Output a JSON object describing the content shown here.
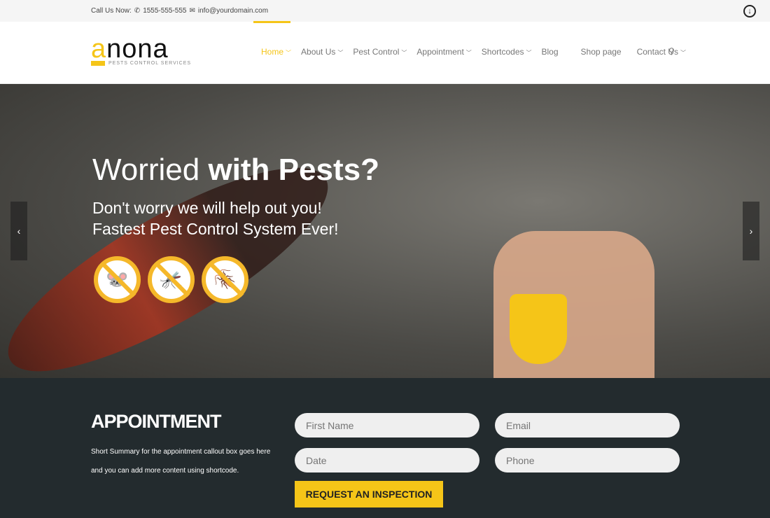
{
  "topbar": {
    "call_label": "Call Us Now:",
    "phone": "1555-555-555",
    "email": "info@yourdomain.com"
  },
  "logo": {
    "word_a": "a",
    "word_rest": "nona",
    "tagline": "PESTS CONTROL SERVICES"
  },
  "nav": {
    "items": [
      {
        "label": "Home",
        "dropdown": true
      },
      {
        "label": "About Us",
        "dropdown": true
      },
      {
        "label": "Pest Control",
        "dropdown": true
      },
      {
        "label": "Appointment",
        "dropdown": true
      },
      {
        "label": "Shortcodes",
        "dropdown": true
      },
      {
        "label": "Blog",
        "dropdown": false
      },
      {
        "label": "Shop page",
        "dropdown": false
      },
      {
        "label": "Contact Us",
        "dropdown": true
      }
    ]
  },
  "hero": {
    "title_light": "Worried ",
    "title_bold": "with Pests?",
    "line1": "Don't worry we will help out you!",
    "line2": "Fastest Pest Control System Ever!",
    "icons": [
      "no-mouse-icon",
      "no-mosquito-icon",
      "no-cockroach-icon"
    ]
  },
  "appointment": {
    "title": "APPOINTMENT",
    "summary": "Short Summary for the appointment callout box goes here and you can add more content using shortcode.",
    "fields": {
      "first_name": "First Name",
      "email": "Email",
      "date": "Date",
      "phone": "Phone"
    },
    "button": "REQUEST AN INSPECTION"
  },
  "colors": {
    "accent": "#f5c518",
    "dark": "#232b2e"
  }
}
